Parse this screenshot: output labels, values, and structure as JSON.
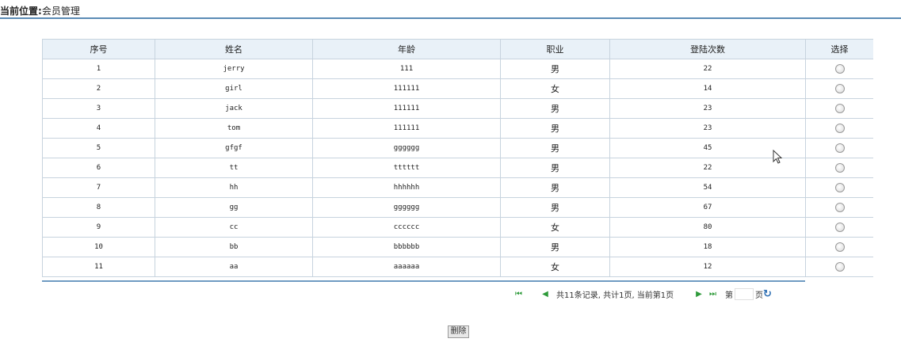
{
  "breadcrumb": {
    "label": "当前位置:",
    "page": "会员管理"
  },
  "table": {
    "headers": [
      "序号",
      "姓名",
      "年龄",
      "职业",
      "登陆次数",
      "选择"
    ],
    "rows": [
      [
        "1",
        "jerry",
        "111",
        "男",
        "22"
      ],
      [
        "2",
        "girl",
        "111111",
        "女",
        "14"
      ],
      [
        "3",
        "jack",
        "111111",
        "男",
        "23"
      ],
      [
        "4",
        "tom",
        "111111",
        "男",
        "23"
      ],
      [
        "5",
        "gfgf",
        "gggggg",
        "男",
        "45"
      ],
      [
        "6",
        "tt",
        "tttttt",
        "男",
        "22"
      ],
      [
        "7",
        "hh",
        "hhhhhh",
        "男",
        "54"
      ],
      [
        "8",
        "gg",
        "gggggg",
        "男",
        "67"
      ],
      [
        "9",
        "cc",
        "cccccc",
        "女",
        "80"
      ],
      [
        "10",
        "bb",
        "bbbbbb",
        "男",
        "18"
      ],
      [
        "11",
        "aa",
        "aaaaaa",
        "女",
        "12"
      ]
    ]
  },
  "pager": {
    "first": "⏮",
    "prev": "◀",
    "info": "共11条记录, 共计1页, 当前第1页",
    "next": "▶",
    "last": "⏭",
    "page_prefix": "第",
    "page_value": "",
    "page_suffix": "页",
    "go_icon": "↻"
  },
  "actions": {
    "delete_label": "删除"
  },
  "icons": {
    "first": "first-page-icon",
    "prev": "prev-page-icon",
    "next": "next-page-icon",
    "last": "last-page-icon",
    "go": "refresh-go-icon",
    "cursor": "mouse-cursor-icon"
  },
  "colors": {
    "header_bg": "#e9f1f8",
    "border": "#c7d3de",
    "accent_line": "#5b8bb5",
    "pager_green": "#2e9a3a"
  }
}
